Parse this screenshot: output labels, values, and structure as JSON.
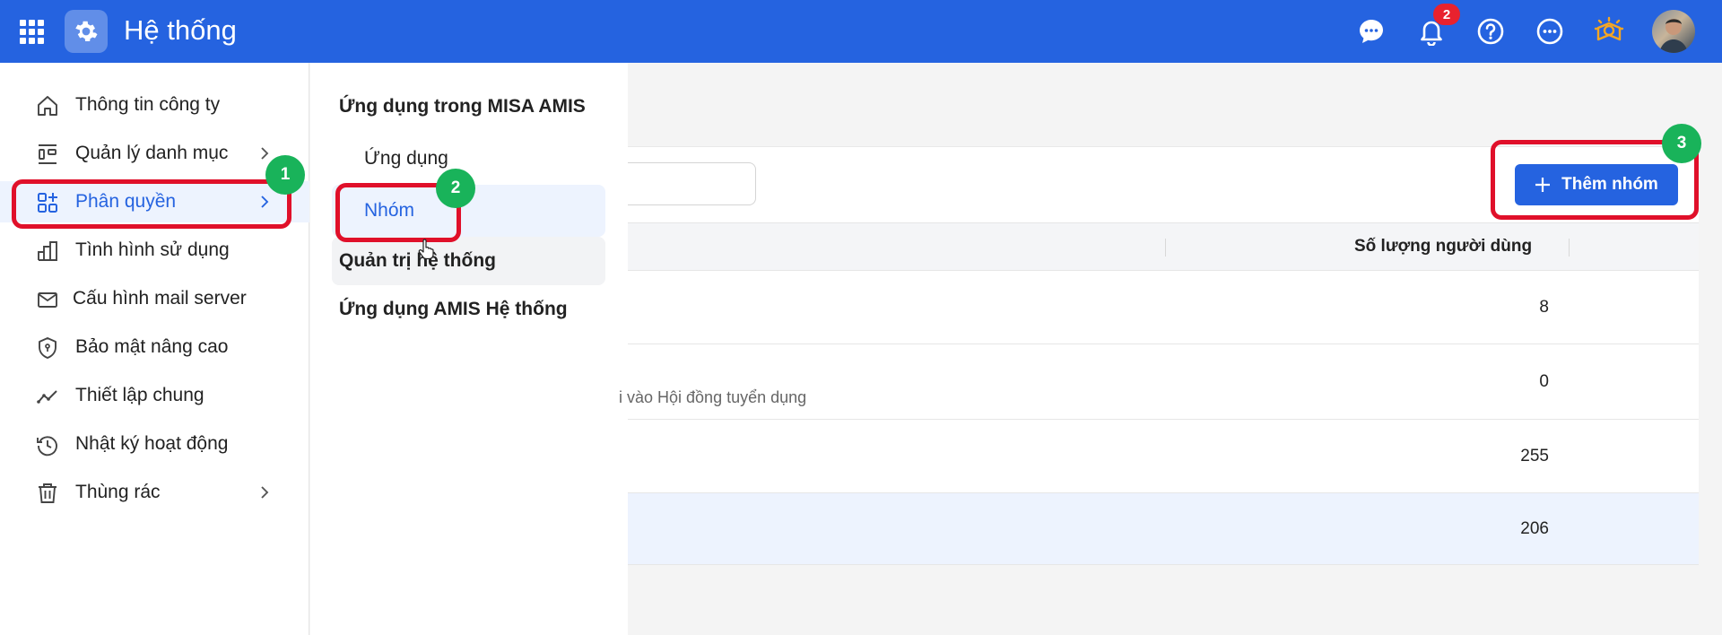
{
  "header": {
    "title": "Hệ thống",
    "notification_count": "2",
    "icons": [
      "apps-grid-icon",
      "gear-icon",
      "chat-icon",
      "bell-icon",
      "help-icon",
      "more-icon",
      "lightbulb-icon",
      "avatar"
    ],
    "accent_color": "#2563e0"
  },
  "sidebar": {
    "items": [
      {
        "label": "Thông tin công ty",
        "icon": "home-icon"
      },
      {
        "label": "Quản lý danh mục",
        "icon": "category-icon"
      },
      {
        "label": "Phân quyền",
        "icon": "permission-icon"
      },
      {
        "label": "Tình hình sử dụng",
        "icon": "bar-chart-icon"
      },
      {
        "label": "Cấu hình mail server",
        "icon": "mail-icon"
      },
      {
        "label": "Bảo mật nâng cao",
        "icon": "shield-icon"
      },
      {
        "label": "Thiết lập chung",
        "icon": "trend-icon"
      },
      {
        "label": "Nhật ký hoạt động",
        "icon": "history-icon"
      },
      {
        "label": "Thùng rác",
        "icon": "trash-icon"
      }
    ]
  },
  "submenu": {
    "section1": "Ứng dụng trong MISA AMIS",
    "items": [
      "Ứng dụng",
      "Nhóm"
    ],
    "section2": "Quản trị hệ thống",
    "section3": "Ứng dụng AMIS Hệ thống"
  },
  "main": {
    "add_button": "Thêm nhóm",
    "column_user_count": "Số lượng người dùng",
    "rows": [
      {
        "count": "8"
      },
      {
        "count": "0",
        "description": "i vào Hội đồng tuyển dụng"
      },
      {
        "count": "255"
      },
      {
        "count": "206"
      }
    ]
  },
  "annotations": {
    "step1": "1",
    "step2": "2",
    "step3": "3",
    "highlight_color": "#e0102a",
    "step_color": "#19b35a"
  }
}
